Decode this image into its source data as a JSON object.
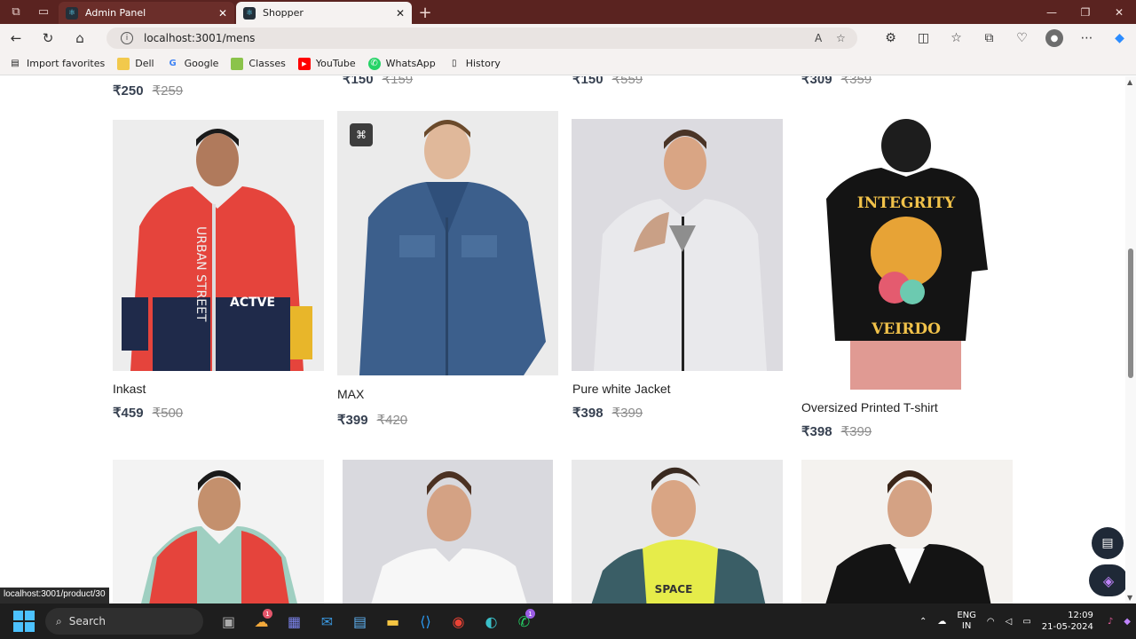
{
  "browser": {
    "tabs": [
      {
        "label": "Admin Panel",
        "active": false
      },
      {
        "label": "Shopper",
        "active": true
      }
    ],
    "url": "localhost:3001/mens",
    "bookmarks": [
      "Import favorites",
      "Dell",
      "Google",
      "Classes",
      "YouTube",
      "WhatsApp",
      "History"
    ]
  },
  "top_row_prices": [
    {
      "new": "₹250",
      "old": "₹259"
    },
    {
      "new": "₹150",
      "old": "₹159"
    },
    {
      "new": "₹150",
      "old": "₹559"
    },
    {
      "new": "₹309",
      "old": "₹359"
    }
  ],
  "products": [
    {
      "name": "Inkast",
      "new_price": "₹459",
      "old_price": "₹500"
    },
    {
      "name": "MAX",
      "new_price": "₹399",
      "old_price": "₹420"
    },
    {
      "name": "Pure white Jacket",
      "new_price": "₹398",
      "old_price": "₹399"
    },
    {
      "name": "Oversized Printed T-shirt",
      "new_price": "₹398",
      "old_price": "₹399"
    }
  ],
  "jacket_text": {
    "vertical": "URBAN STREET",
    "actve": "ACTVE"
  },
  "tshirt_text": {
    "top": "INTEGRITY",
    "bottom": "VEIRDO"
  },
  "hoodie_text": "SPACE",
  "status_link": "localhost:3001/product/30",
  "taskbar": {
    "search_placeholder": "Search",
    "lang_top": "ENG",
    "lang_bottom": "IN",
    "time": "12:09",
    "date": "21-05-2024",
    "badge_count": "1"
  },
  "colors": {
    "titlebar": "#5a2320",
    "price": "#374151",
    "old_price": "#8c8c8c"
  }
}
